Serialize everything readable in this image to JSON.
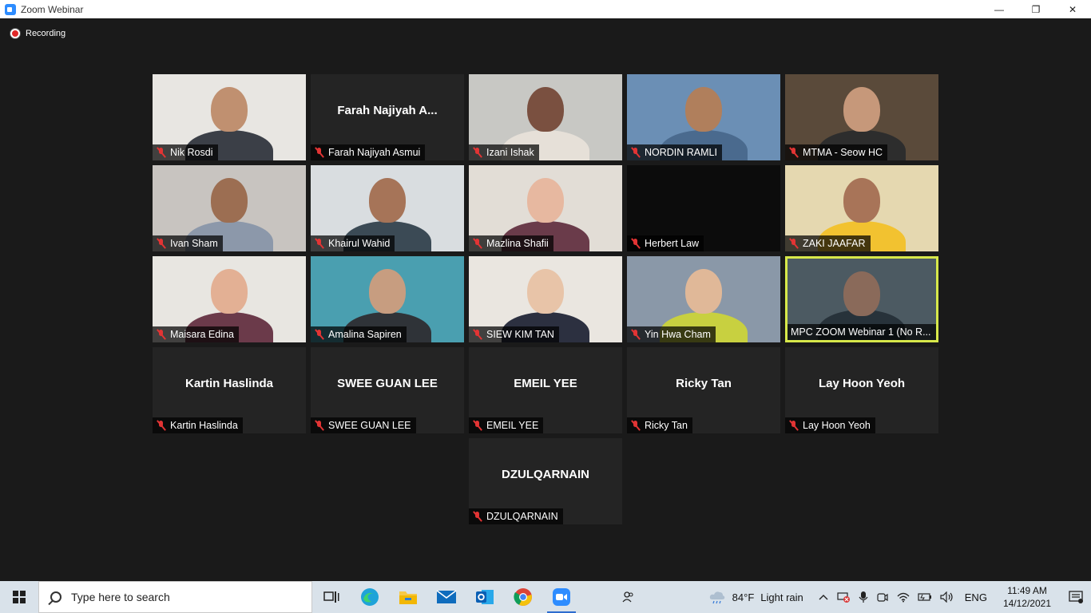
{
  "window": {
    "title": "Zoom Webinar",
    "minimize": "—",
    "restore": "❐",
    "close": "✕"
  },
  "recording": {
    "label": "Recording",
    "color": "#e02828"
  },
  "participants": [
    {
      "name": "Nik Rosdi",
      "video": true,
      "muted": true
    },
    {
      "name": "Farah Najiyah Asmui",
      "display_name": "Farah Najiyah A...",
      "video": false,
      "muted": true
    },
    {
      "name": "Izani Ishak",
      "video": true,
      "muted": true
    },
    {
      "name": "NORDIN RAMLI",
      "video": true,
      "muted": true
    },
    {
      "name": "MTMA - Seow HC",
      "video": true,
      "muted": true
    },
    {
      "name": "Ivan Sham",
      "video": true,
      "muted": true
    },
    {
      "name": "Khairul Wahid",
      "video": true,
      "muted": true
    },
    {
      "name": "Mazlina Shafii",
      "video": true,
      "muted": true
    },
    {
      "name": "Herbert Law",
      "video": true,
      "muted": true
    },
    {
      "name": "ZAKI JAAFAR",
      "video": true,
      "muted": true
    },
    {
      "name": "Maisara Edina",
      "video": true,
      "muted": true
    },
    {
      "name": "Amalina Sapiren",
      "video": true,
      "muted": true
    },
    {
      "name": "SIEW KIM TAN",
      "video": true,
      "muted": true
    },
    {
      "name": "Yin Hwa Cham",
      "video": true,
      "muted": true
    },
    {
      "name": "MPC ZOOM Webinar 1 (No R...",
      "video": true,
      "muted": false,
      "active_speaker": true
    },
    {
      "name": "Kartin Haslinda",
      "display_name": "Kartin Haslinda",
      "video": false,
      "muted": true
    },
    {
      "name": "SWEE GUAN LEE",
      "display_name": "SWEE GUAN LEE",
      "video": false,
      "muted": true
    },
    {
      "name": "EMEIL YEE",
      "display_name": "EMEIL YEE",
      "video": false,
      "muted": true
    },
    {
      "name": "Ricky Tan",
      "display_name": "Ricky Tan",
      "video": false,
      "muted": true
    },
    {
      "name": "Lay Hoon Yeoh",
      "display_name": "Lay Hoon Yeoh",
      "video": false,
      "muted": true
    },
    {
      "name": "DZULQARNAIN",
      "display_name": "DZULQARNAIN",
      "video": false,
      "muted": true
    }
  ],
  "active_speaker_color": "#d7e84a",
  "taskbar": {
    "search_placeholder": "Type here to search",
    "pinned_apps": [
      "task-view",
      "edge",
      "file-explorer",
      "mail",
      "outlook",
      "chrome",
      "zoom"
    ],
    "weather": {
      "temperature": "84°F",
      "condition": "Light rain"
    },
    "language": "ENG",
    "time": "11:49 AM",
    "date": "14/12/2021"
  }
}
